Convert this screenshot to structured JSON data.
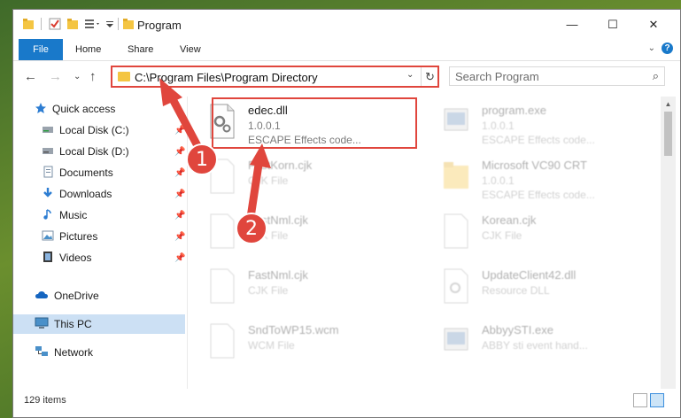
{
  "window": {
    "title": "Program",
    "minimize": "—",
    "maximize": "☐",
    "close": "✕"
  },
  "ribbon": {
    "file": "File",
    "home": "Home",
    "share": "Share",
    "view": "View"
  },
  "address": {
    "path": "C:\\Program Files\\Program Directory"
  },
  "search": {
    "placeholder": "Search Program"
  },
  "sidebar": {
    "items": [
      {
        "label": "Quick access"
      },
      {
        "label": "Local Disk (C:)"
      },
      {
        "label": "Local Disk (D:)"
      },
      {
        "label": "Documents"
      },
      {
        "label": "Downloads"
      },
      {
        "label": "Music"
      },
      {
        "label": "Pictures"
      },
      {
        "label": "Videos"
      },
      {
        "label": "OneDrive"
      },
      {
        "label": "This PC"
      },
      {
        "label": "Network"
      }
    ]
  },
  "files": [
    {
      "name": "edec.dll",
      "line1": "1.0.0.1",
      "line2": "ESCAPE Effects code..."
    },
    {
      "name": "program.exe",
      "line1": "1.0.0.1",
      "line2": "ESCAPE Effects code..."
    },
    {
      "name": "FastKorn.cjk",
      "line1": "CJK File",
      "line2": ""
    },
    {
      "name": "Microsoft VC90 CRT",
      "line1": "1.0.0.1",
      "line2": "ESCAPE Effects code..."
    },
    {
      "name": "FastNml.cjk",
      "line1": "CJK File",
      "line2": ""
    },
    {
      "name": "Korean.cjk",
      "line1": "CJK File",
      "line2": ""
    },
    {
      "name": "FastNml.cjk",
      "line1": "CJK File",
      "line2": ""
    },
    {
      "name": "UpdateClient42.dll",
      "line1": "Resource DLL",
      "line2": ""
    },
    {
      "name": "SndToWP15.wcm",
      "line1": "WCM File",
      "line2": ""
    },
    {
      "name": "AbbyySTI.exe",
      "line1": "ABBY sti event hand...",
      "line2": ""
    }
  ],
  "status": {
    "count": "129 items"
  },
  "callouts": {
    "one": "1",
    "two": "2"
  }
}
